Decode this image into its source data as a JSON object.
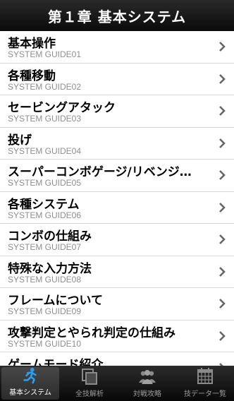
{
  "header": {
    "title": "第１章 基本システム"
  },
  "list": {
    "items": [
      {
        "title": "基本操作",
        "subtitle": "SYSTEM GUIDE01"
      },
      {
        "title": "各種移動",
        "subtitle": "SYSTEM GUIDE02"
      },
      {
        "title": "セービングアタック",
        "subtitle": "SYSTEM GUIDE03"
      },
      {
        "title": "投げ",
        "subtitle": "SYSTEM GUIDE04"
      },
      {
        "title": "スーパーコンボゲージ/リベンジ…",
        "subtitle": "SYSTEM GUIDE05"
      },
      {
        "title": "各種システム",
        "subtitle": "SYSTEM GUIDE06"
      },
      {
        "title": "コンボの仕組み",
        "subtitle": "SYSTEM GUIDE07"
      },
      {
        "title": "特殊な入力方法",
        "subtitle": "SYSTEM GUIDE08"
      },
      {
        "title": "フレームについて",
        "subtitle": "SYSTEM GUIDE09"
      },
      {
        "title": "攻撃判定とやられ判定の仕組み",
        "subtitle": "SYSTEM GUIDE10"
      },
      {
        "title": "ゲームモード紹介",
        "subtitle": ""
      }
    ]
  },
  "tabbar": {
    "tabs": [
      {
        "label": "基本システム",
        "icon": "running-figure-icon",
        "active": true
      },
      {
        "label": "全技解析",
        "icon": "stacked-pages-icon",
        "active": false
      },
      {
        "label": "対戦攻略",
        "icon": "people-icon",
        "active": false
      },
      {
        "label": "技データ一覧",
        "icon": "calendar-grid-icon",
        "active": false
      }
    ]
  },
  "colors": {
    "accent": "#1e90ff",
    "navbar": "#111111",
    "subtitle": "#8e8e8e"
  }
}
